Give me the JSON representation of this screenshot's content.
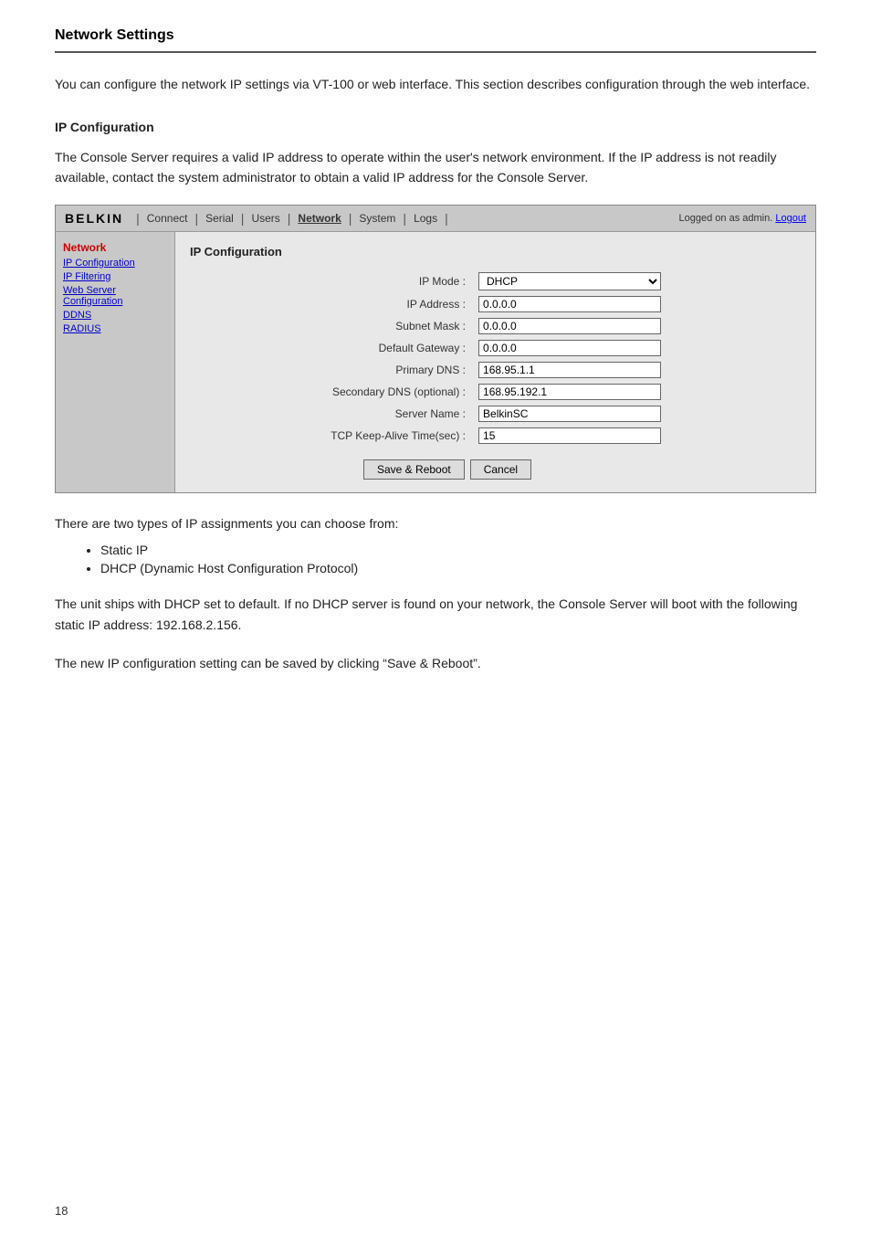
{
  "page": {
    "title": "Network Settings",
    "page_number": "18",
    "intro_paragraph": "You can configure the network IP settings via VT-100 or web interface. This section describes configuration through the web interface.",
    "ip_config_heading": "IP Configuration",
    "ip_config_desc": "The Console Server requires a valid IP address to operate within the user's network environment. If the IP address is not readily available, contact the system administrator to obtain a valid IP address for the Console Server."
  },
  "nav": {
    "brand": "BELKIN",
    "links": [
      "Connect",
      "Serial",
      "Users",
      "Network",
      "System",
      "Logs"
    ],
    "active_link": "Network",
    "logged_text": "Logged on as admin.",
    "logout_label": "Logout"
  },
  "sidebar": {
    "section_label": "Network",
    "items": [
      {
        "label": "IP Configuration",
        "active": true
      },
      {
        "label": "IP Filtering"
      },
      {
        "label": "Web Server Configuration"
      },
      {
        "label": "DDNS"
      },
      {
        "label": "RADIUS"
      }
    ]
  },
  "form": {
    "title": "IP Configuration",
    "fields": [
      {
        "label": "IP Mode :",
        "type": "select",
        "value": "DHCP",
        "name": "ip-mode"
      },
      {
        "label": "IP Address :",
        "type": "text",
        "value": "0.0.0.0",
        "name": "ip-address"
      },
      {
        "label": "Subnet Mask :",
        "type": "text",
        "value": "0.0.0.0",
        "name": "subnet-mask"
      },
      {
        "label": "Default Gateway :",
        "type": "text",
        "value": "0.0.0.0",
        "name": "default-gateway"
      },
      {
        "label": "Primary DNS :",
        "type": "text",
        "value": "168.95.1.1",
        "name": "primary-dns"
      },
      {
        "label": "Secondary DNS (optional) :",
        "type": "text",
        "value": "168.95.192.1",
        "name": "secondary-dns"
      },
      {
        "label": "Server Name :",
        "type": "text",
        "value": "BelkinSC",
        "name": "server-name"
      },
      {
        "label": "TCP Keep-Alive Time(sec) :",
        "type": "text",
        "value": "15",
        "name": "tcp-keepalive"
      }
    ],
    "save_reboot_label": "Save & Reboot",
    "cancel_label": "Cancel"
  },
  "lower_section": {
    "text1": "There are two types of IP assignments you can choose from:",
    "bullets": [
      "Static IP",
      "DHCP (Dynamic Host Configuration Protocol)"
    ],
    "text2": "The unit ships with DHCP set to default. If no DHCP server is found on your network, the Console Server will boot with the following static IP address: 192.168.2.156.",
    "text3": "The new IP configuration setting can be saved by clicking “Save & Reboot”."
  }
}
